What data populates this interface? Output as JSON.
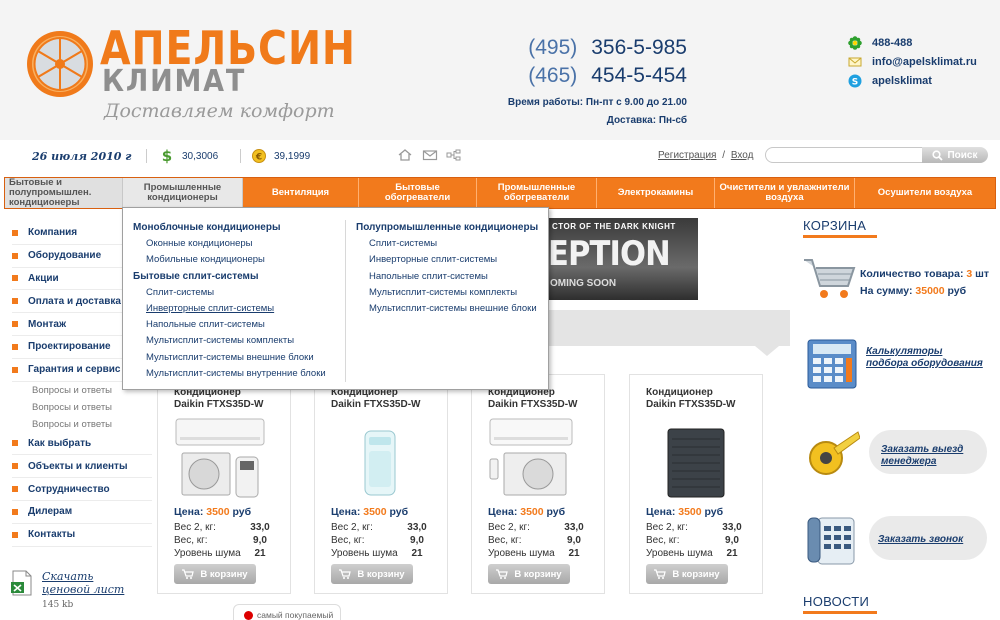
{
  "brand": {
    "title": "АПЕЛЬСИН",
    "subtitle": "КЛИМАТ",
    "slogan": "Доставляем комфорт",
    "color": "#f27a1c"
  },
  "phones": [
    {
      "code": "(495)",
      "number": "356-5-985"
    },
    {
      "code": "(465)",
      "number": "454-5-454"
    }
  ],
  "work_hours": "Время работы: Пн-пт с 9.00 до 21.00",
  "delivery": "Доставка: Пн-сб",
  "contacts": [
    {
      "icon": "icq-icon",
      "text": "488-488"
    },
    {
      "icon": "email-icon",
      "text": "info@apelsklimat.ru"
    },
    {
      "icon": "skype-icon",
      "text": "apelsklimat"
    }
  ],
  "infobar": {
    "date": "26 июля 2010 г",
    "usd_rate": "30,3006",
    "eur_rate": "39,1999",
    "register": "Регистрация",
    "divider": "/",
    "login": "Вход",
    "search_placeholder": "",
    "search_button": "Поиск"
  },
  "nav": [
    "Бытовые и полупромышлен. кондиционеры",
    "Промышленные кондиционеры",
    "Вентиляция",
    "Бытовые обогреватели",
    "Промышленные обогреватели",
    "Электрокамины",
    "Очистители и увлажнители воздуха",
    "Осушители воздуха"
  ],
  "dropdown": {
    "left": {
      "head1": "Моноблочные кондиционеры",
      "items1": [
        "Оконные кондиционеры",
        "Мобильные кондиционеры"
      ],
      "head2": "Бытовые сплит-системы",
      "items2": [
        "Сплит-системы",
        "Инверторные сплит-системы",
        "Напольные сплит-системы",
        "Мультисплит-системы комплекты",
        "Мультисплит-системы внешние блоки",
        "Мультисплит-системы внутренние блоки"
      ]
    },
    "right": {
      "head1": "Полупромышленные кондиционеры",
      "items1": [
        "Сплит-системы",
        "Инверторные сплит-системы",
        "Напольные сплит-системы",
        "Мультисплит-системы комплекты",
        "Мультисплит-системы внешние блоки"
      ]
    }
  },
  "sidebar": {
    "items": [
      "Компания",
      "Оборудование",
      "Акции",
      "Оплата и доставка",
      "Монтаж",
      "Проектирование",
      "Гарантия и сервис"
    ],
    "sub": [
      "Вопросы и ответы",
      "Вопросы и ответы",
      "Вопросы и ответы"
    ],
    "items_after": [
      "Как выбрать",
      "Объекты и клиенты",
      "Сотрудничество",
      "Дилерам",
      "Контакты"
    ]
  },
  "download": {
    "line1": "Скачать",
    "line2": "ценовой лист",
    "size": "145 kb"
  },
  "banner": {
    "line1": "CTOR OF THE DARK KNIGHT",
    "line2": "EPTION",
    "line3": "OMING SOON"
  },
  "products": [
    {
      "name1": "Кондиционер",
      "name2": "Daikin FTXS35D-W",
      "price_label": "Цена:",
      "price": "3500",
      "currency": "руб",
      "weight2_label": "Вес 2, кг:",
      "weight2": "33,0",
      "weight_label": "Вес, кг:",
      "weight": "9,0",
      "noise_label": "Уровень шума",
      "noise": "21",
      "button": "В корзину"
    },
    {
      "name1": "Кондиционер",
      "name2": "Daikin FTXS35D-W",
      "price_label": "Цена:",
      "price": "3500",
      "currency": "руб",
      "weight2_label": "Вес 2, кг:",
      "weight2": "33,0",
      "weight_label": "Вес, кг:",
      "weight": "9,0",
      "noise_label": "Уровень шума",
      "noise": "21",
      "button": "В корзину"
    },
    {
      "name1": "Кондиционер",
      "name2": "Daikin FTXS35D-W",
      "price_label": "Цена:",
      "price": "3500",
      "currency": "руб",
      "weight2_label": "Вес 2, кг:",
      "weight2": "33,0",
      "weight_label": "Вес, кг:",
      "weight": "9,0",
      "noise_label": "Уровень шума",
      "noise": "21",
      "button": "В корзину"
    },
    {
      "name1": "Кондиционер",
      "name2": "Daikin FTXS35D-W",
      "price_label": "Цена:",
      "price": "3500",
      "currency": "руб",
      "weight2_label": "Вес 2, кг:",
      "weight2": "33,0",
      "weight_label": "Вес, кг:",
      "weight": "9,0",
      "noise_label": "Уровень шума",
      "noise": "21",
      "button": "В корзину"
    }
  ],
  "popular": "самый покупаемый",
  "cart": {
    "title": "КОРЗИНА",
    "count_label": "Количество товара:",
    "count": "3",
    "count_unit": "шт",
    "sum_label": "На сумму:",
    "sum": "35000",
    "sum_unit": "руб"
  },
  "calc_link": "Калькуляторы подбора оборудования",
  "manager_link": "Заказать выезд менеджера",
  "call_link": "Заказать звонок",
  "news_title": "НОВОСТИ"
}
